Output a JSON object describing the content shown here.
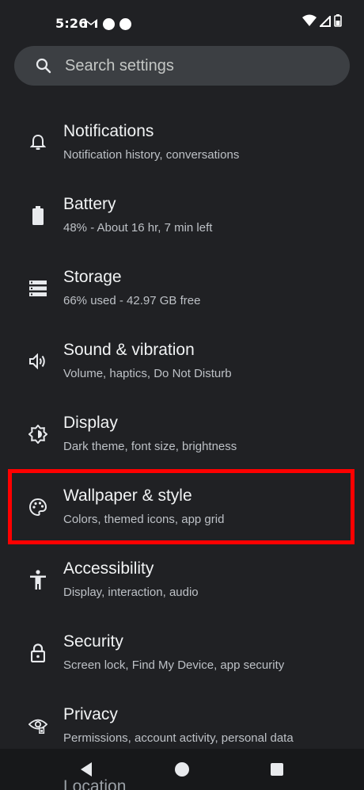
{
  "status_bar": {
    "time": "5:26",
    "left_icons": [
      "gmail-icon",
      "notification-dot-icon",
      "notification-dot-icon"
    ],
    "right_icons": [
      "wifi-icon",
      "signal-icon",
      "battery-icon"
    ]
  },
  "search": {
    "placeholder": "Search settings"
  },
  "settings": [
    {
      "icon": "bell-icon",
      "title": "Notifications",
      "subtitle": "Notification history, conversations"
    },
    {
      "icon": "battery-icon",
      "title": "Battery",
      "subtitle": "48% - About 16 hr, 7 min left"
    },
    {
      "icon": "storage-icon",
      "title": "Storage",
      "subtitle": "66% used - 42.97 GB free"
    },
    {
      "icon": "speaker-icon",
      "title": "Sound & vibration",
      "subtitle": "Volume, haptics, Do Not Disturb"
    },
    {
      "icon": "brightness-icon",
      "title": "Display",
      "subtitle": "Dark theme, font size, brightness"
    },
    {
      "icon": "palette-icon",
      "title": "Wallpaper & style",
      "subtitle": "Colors, themed icons, app grid",
      "highlighted": true
    },
    {
      "icon": "accessibility-icon",
      "title": "Accessibility",
      "subtitle": "Display, interaction, audio"
    },
    {
      "icon": "lock-icon",
      "title": "Security",
      "subtitle": "Screen lock, Find My Device, app security"
    },
    {
      "icon": "eye-icon",
      "title": "Privacy",
      "subtitle": "Permissions, account activity, personal data"
    }
  ],
  "next_item_peek": "Location",
  "nav_bar": {
    "buttons": [
      "back-icon",
      "home-icon",
      "recents-icon"
    ]
  },
  "colors": {
    "background": "#202124",
    "highlight": "#ff0000"
  }
}
